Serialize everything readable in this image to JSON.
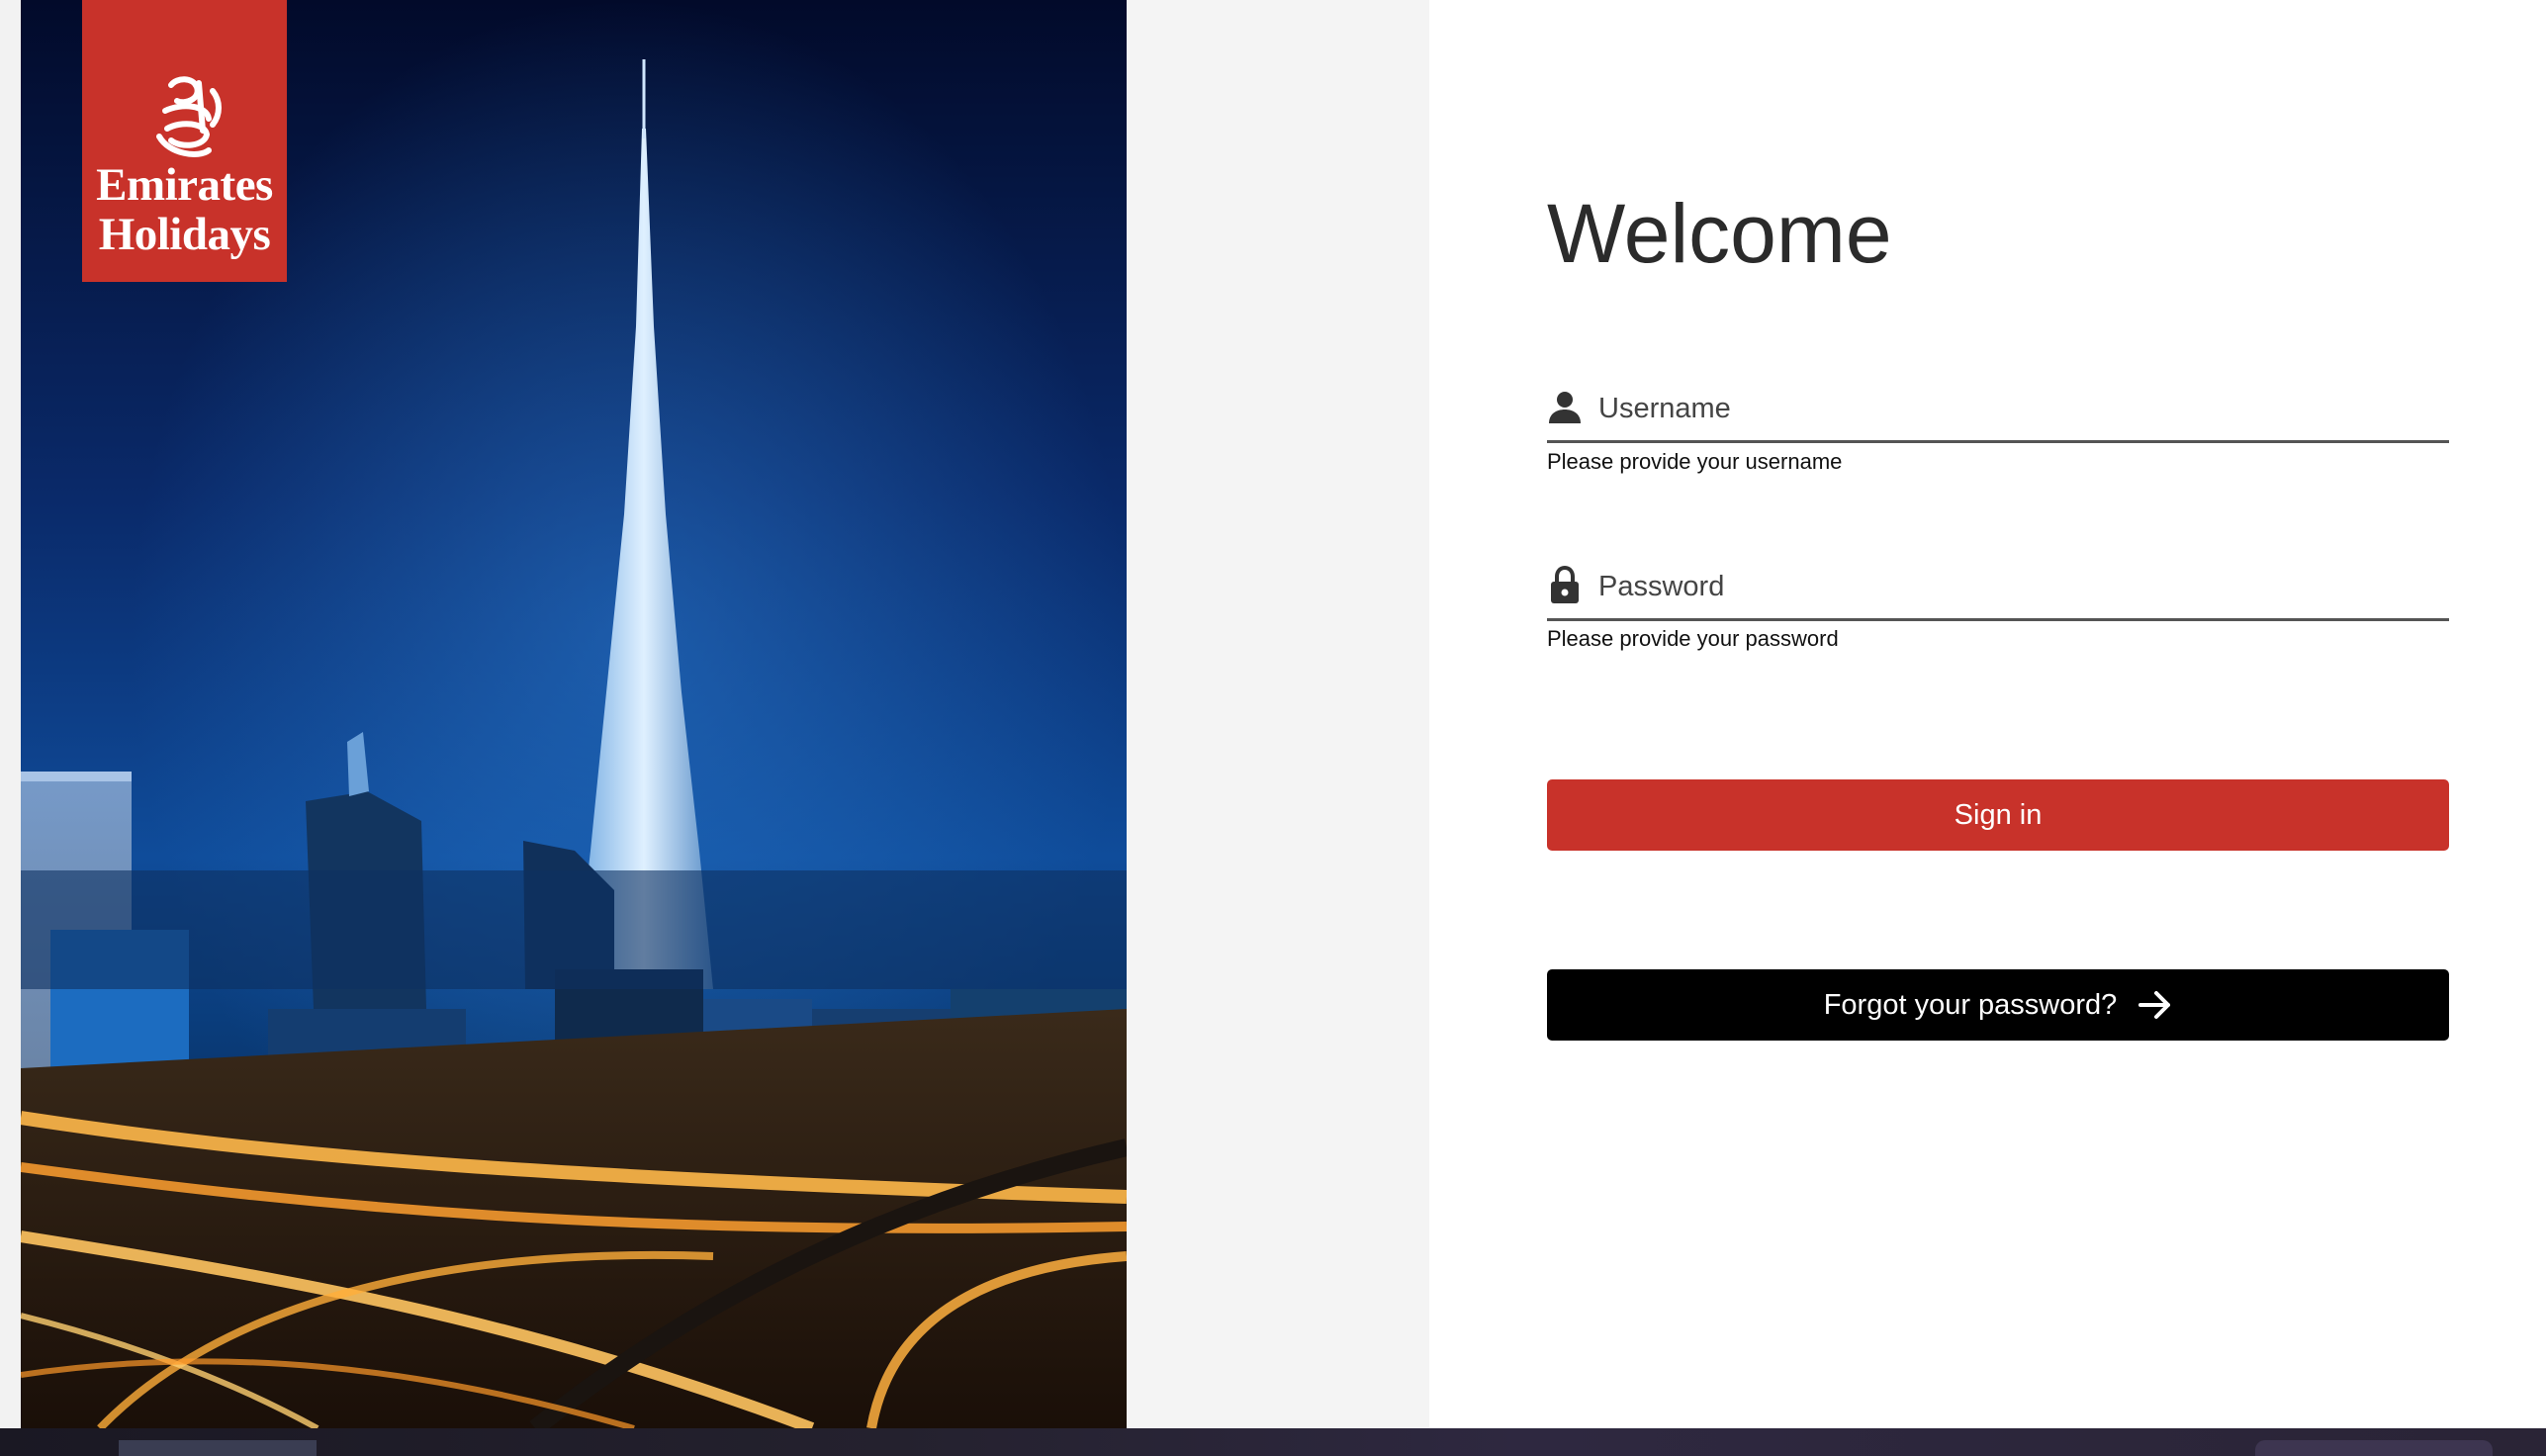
{
  "brand": {
    "line1": "Emirates",
    "line2": "Holidays",
    "color": "#c8322a"
  },
  "hero": {
    "icon": "city-skyline-night-image"
  },
  "form": {
    "title": "Welcome",
    "username": {
      "icon": "person-icon",
      "placeholder": "Username",
      "value": "",
      "helper": "Please provide your username"
    },
    "password": {
      "icon": "lock-icon",
      "placeholder": "Password",
      "value": "",
      "helper": "Please provide your password"
    },
    "signin_label": "Sign in",
    "forgot_label": "Forgot your password?",
    "forgot_icon": "arrow-right-icon"
  },
  "colors": {
    "accent": "#c8322a",
    "dark_button": "#000000",
    "text": "#2b2b2b"
  }
}
